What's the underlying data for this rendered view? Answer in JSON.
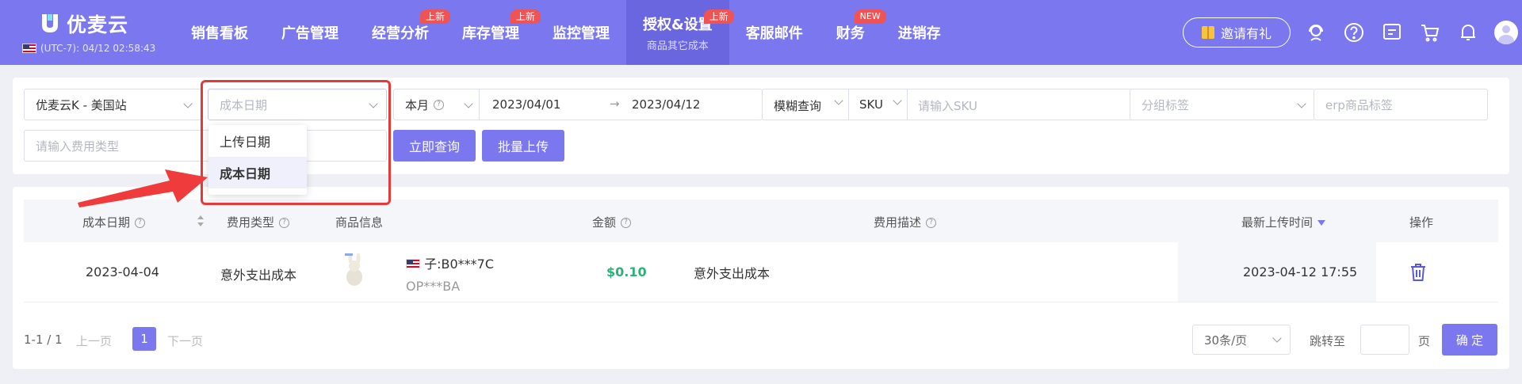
{
  "header": {
    "logo_text": "优麦云",
    "timezone": "(UTC-7): 04/12 02:58:43",
    "nav": [
      {
        "label": "销售看板",
        "badge": "",
        "sub": ""
      },
      {
        "label": "广告管理",
        "badge": "",
        "sub": ""
      },
      {
        "label": "经营分析",
        "badge": "上新",
        "sub": ""
      },
      {
        "label": "库存管理",
        "badge": "上新",
        "sub": ""
      },
      {
        "label": "监控管理",
        "badge": "",
        "sub": ""
      },
      {
        "label": "授权&设置",
        "badge": "上新",
        "sub": "商品其它成本",
        "active": true
      },
      {
        "label": "客服邮件",
        "badge": "",
        "sub": ""
      },
      {
        "label": "财务",
        "badge": "NEW",
        "sub": ""
      },
      {
        "label": "进销存",
        "badge": "",
        "sub": ""
      }
    ],
    "invite_label": "邀请有礼"
  },
  "filters": {
    "shop": "优麦云K - 美国站",
    "date_type_placeholder": "成本日期",
    "period": "本月",
    "date_start": "2023/04/01",
    "date_sep": "→",
    "date_end": "2023/04/12",
    "match_mode": "模糊查询",
    "field_type": "SKU",
    "sku_placeholder": "请输入SKU",
    "group_tag_placeholder": "分组标签",
    "erp_tag_placeholder": "erp商品标签",
    "fee_type_placeholder": "请输入费用类型",
    "query_button": "立即查询",
    "upload_button": "批量上传",
    "dropdown_options": [
      "上传日期",
      "成本日期"
    ],
    "dropdown_selected": "成本日期"
  },
  "table": {
    "headers": {
      "cost_date": "成本日期",
      "fee_type": "费用类型",
      "product_info": "商品信息",
      "amount": "金额",
      "fee_desc": "费用描述",
      "upload_time": "最新上传时间",
      "actions": "操作"
    },
    "rows": [
      {
        "cost_date": "2023-04-04",
        "fee_type": "意外支出成本",
        "child_asin": "子:B0***7C",
        "sku": "OP***BA",
        "amount": "$0.10",
        "fee_desc": "意外支出成本",
        "upload_time": "2023-04-12 17:55"
      }
    ]
  },
  "pagination": {
    "summary": "1-1 / 1",
    "prev": "上一页",
    "current": "1",
    "next": "下一页",
    "page_size": "30条/页",
    "jump_label": "跳转至",
    "page_unit": "页",
    "confirm": "确 定"
  },
  "colors": {
    "primary": "#7b77ee",
    "badge": "#f05353",
    "amount": "#2bb27a",
    "highlight_border": "#e53a3a"
  }
}
